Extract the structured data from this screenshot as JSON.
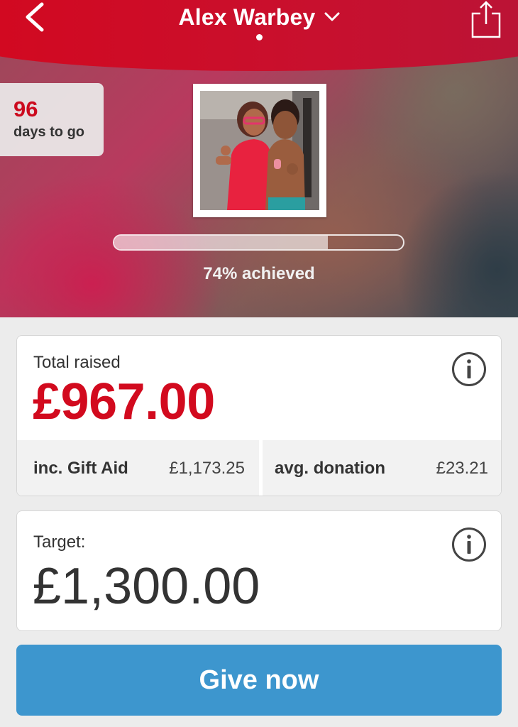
{
  "header": {
    "title": "Alex Warbey",
    "back_icon": "chevron-left-icon",
    "dropdown_icon": "chevron-down-icon",
    "share_icon": "share-icon",
    "brand_color": "#d3081f"
  },
  "hero": {
    "days_count": "96",
    "days_label": "days to go",
    "progress_fraction": 0.74,
    "achieved_text": "74% achieved"
  },
  "totals": {
    "label": "Total raised",
    "amount": "£967.00",
    "gift_aid_label": "inc. Gift Aid",
    "gift_aid_value": "£1,173.25",
    "avg_label": "avg. donation",
    "avg_value": "£23.21",
    "info_icon": "info-icon",
    "amount_color": "#d20a1e"
  },
  "target": {
    "label": "Target:",
    "amount": "£1,300.00",
    "info_icon": "info-icon"
  },
  "actions": {
    "give_label": "Give now",
    "give_color": "#3d96ce"
  }
}
